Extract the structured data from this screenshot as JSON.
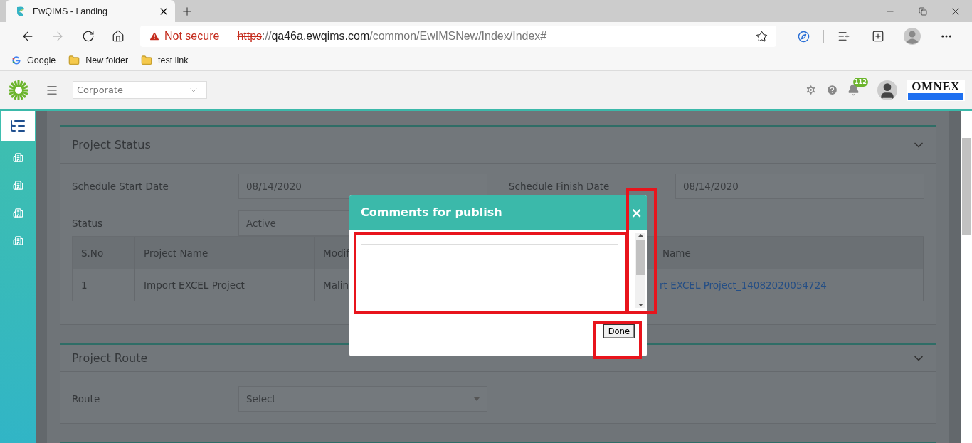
{
  "browser": {
    "tab": {
      "title": "EwQIMS - Landing",
      "selected": true
    },
    "address": {
      "warning": "Not secure",
      "scheme": "https",
      "separator": "://",
      "host": "qa46a.ewqims.com",
      "path": "/common/EwIMSNew/Index/Index#"
    },
    "bookmarks": [
      {
        "label": "Google",
        "kind": "google"
      },
      {
        "label": "New folder",
        "kind": "folder"
      },
      {
        "label": "test link",
        "kind": "folder"
      }
    ]
  },
  "header": {
    "scope": "Corporate",
    "notifications": "112",
    "logo": "OMNEX"
  },
  "sidebar": {
    "items": [
      {
        "selected": true
      },
      {
        "selected": false
      },
      {
        "selected": false
      },
      {
        "selected": false
      },
      {
        "selected": false
      }
    ]
  },
  "project_status": {
    "title": "Project Status",
    "fields": [
      {
        "label": "Schedule Start Date",
        "value": "08/14/2020"
      },
      {
        "label": "Schedule Finish Date",
        "value": "08/14/2020"
      },
      {
        "label": "Status",
        "value": "Active"
      }
    ],
    "table": {
      "columns": [
        "S.No",
        "Project Name",
        "Modif",
        "Name"
      ],
      "rows": [
        [
          "1",
          "Import EXCEL Project",
          "Malin",
          "rt EXCEL Project_14082020054724"
        ]
      ]
    }
  },
  "project_route": {
    "title": "Project Route",
    "label": "Route",
    "placeholder": "Select"
  },
  "dialog": {
    "title": "Comments for publish",
    "close": "×",
    "button": "Done"
  }
}
